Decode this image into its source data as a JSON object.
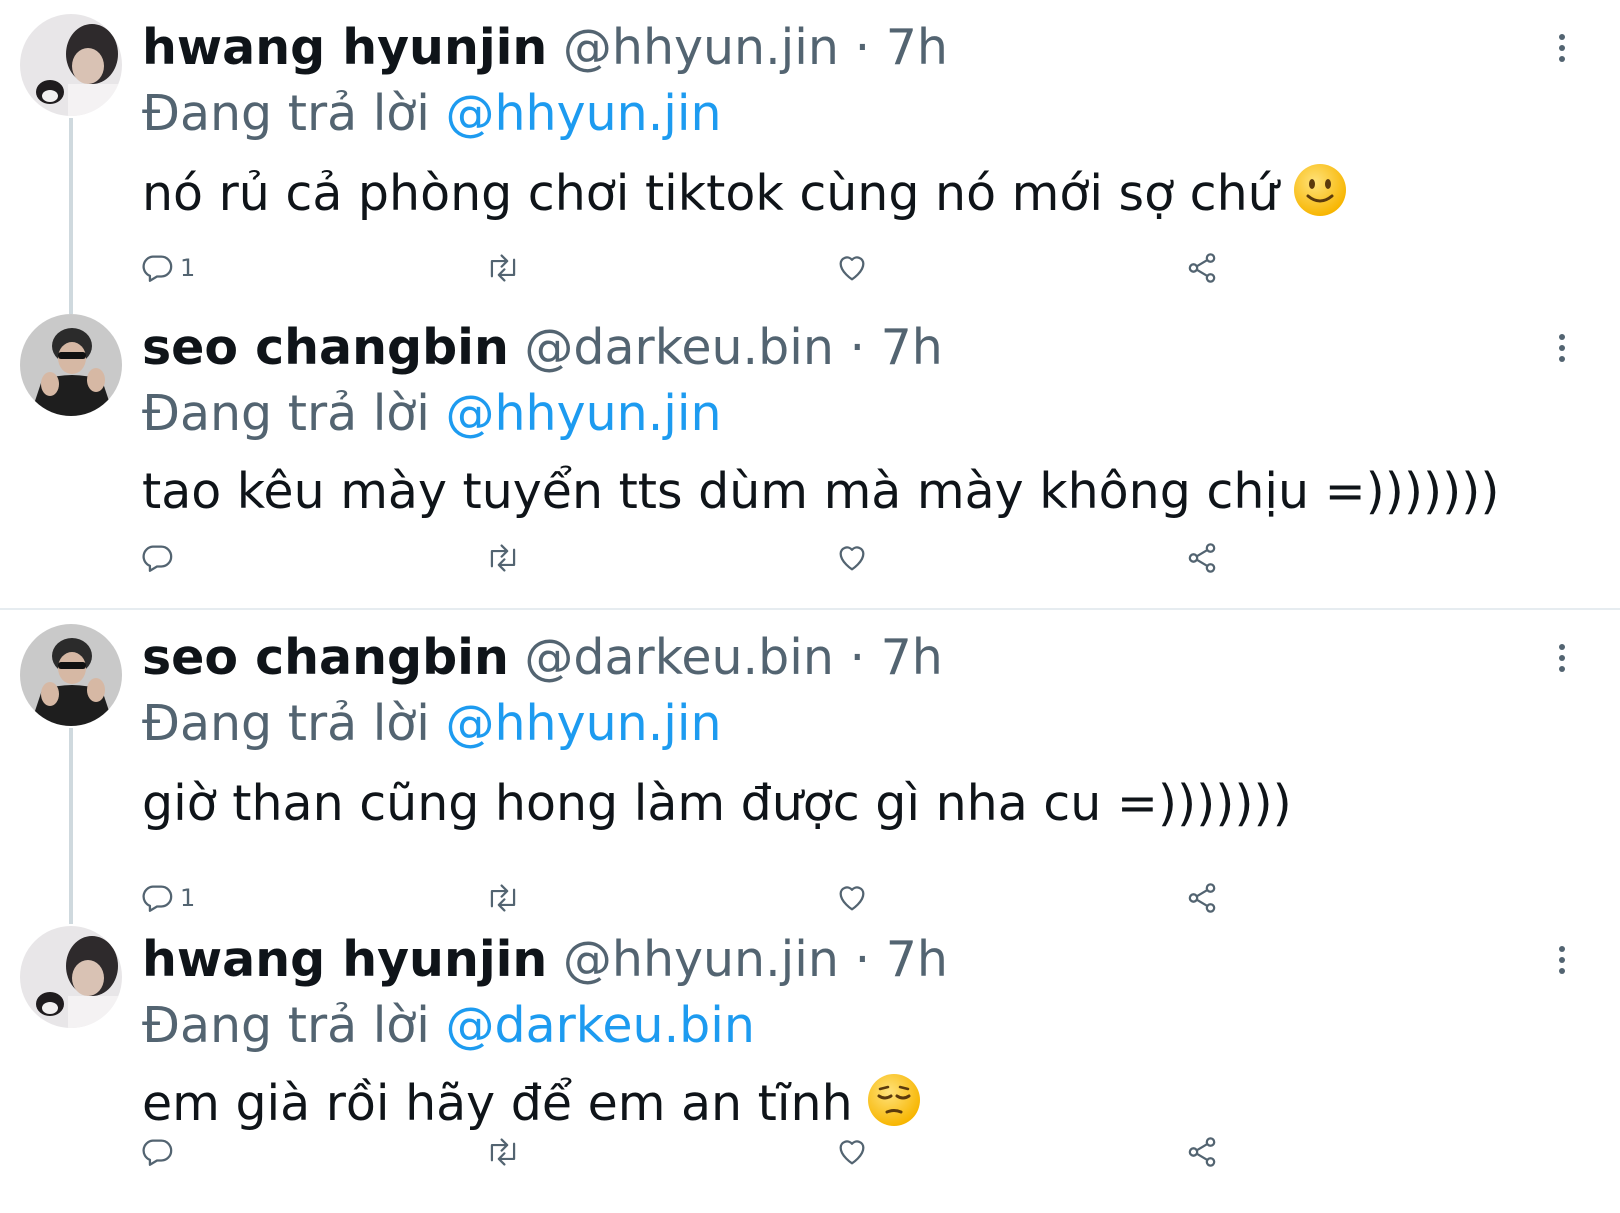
{
  "tweets": [
    {
      "display_name": "hwang hyunjin",
      "handle": "@hhyun.jin",
      "time": "· 7h",
      "replying_prefix": "Đang trả lời",
      "replying_to": "@hhyun.jin",
      "text": "nó rủ cả phòng chơi tiktok cùng nó mới sợ chứ",
      "emoji": "slightly-smiling-face",
      "reply_count": "1"
    },
    {
      "display_name": "seo changbin",
      "handle": "@darkeu.bin",
      "time": "· 7h",
      "replying_prefix": "Đang trả lời",
      "replying_to": "@hhyun.jin",
      "text": "tao kêu mày tuyển tts dùm mà mày không chịu =)))))))",
      "reply_count": ""
    },
    {
      "display_name": "seo changbin",
      "handle": "@darkeu.bin",
      "time": "· 7h",
      "replying_prefix": "Đang trả lời",
      "replying_to": "@hhyun.jin",
      "text": "giờ than cũng hong làm được gì nha cu =)))))))",
      "reply_count": "1"
    },
    {
      "display_name": "hwang hyunjin",
      "handle": "@hhyun.jin",
      "time": "· 7h",
      "replying_prefix": "Đang trả lời",
      "replying_to": "@darkeu.bin",
      "text": "em già rồi hãy để em an tĩnh",
      "emoji": "pensive-face",
      "reply_count": ""
    }
  ],
  "colors": {
    "link": "#1d9bf0",
    "text": "#0f1419",
    "secondary": "#536471",
    "thread_line": "#cfd9de",
    "divider": "#e6ecf0"
  }
}
